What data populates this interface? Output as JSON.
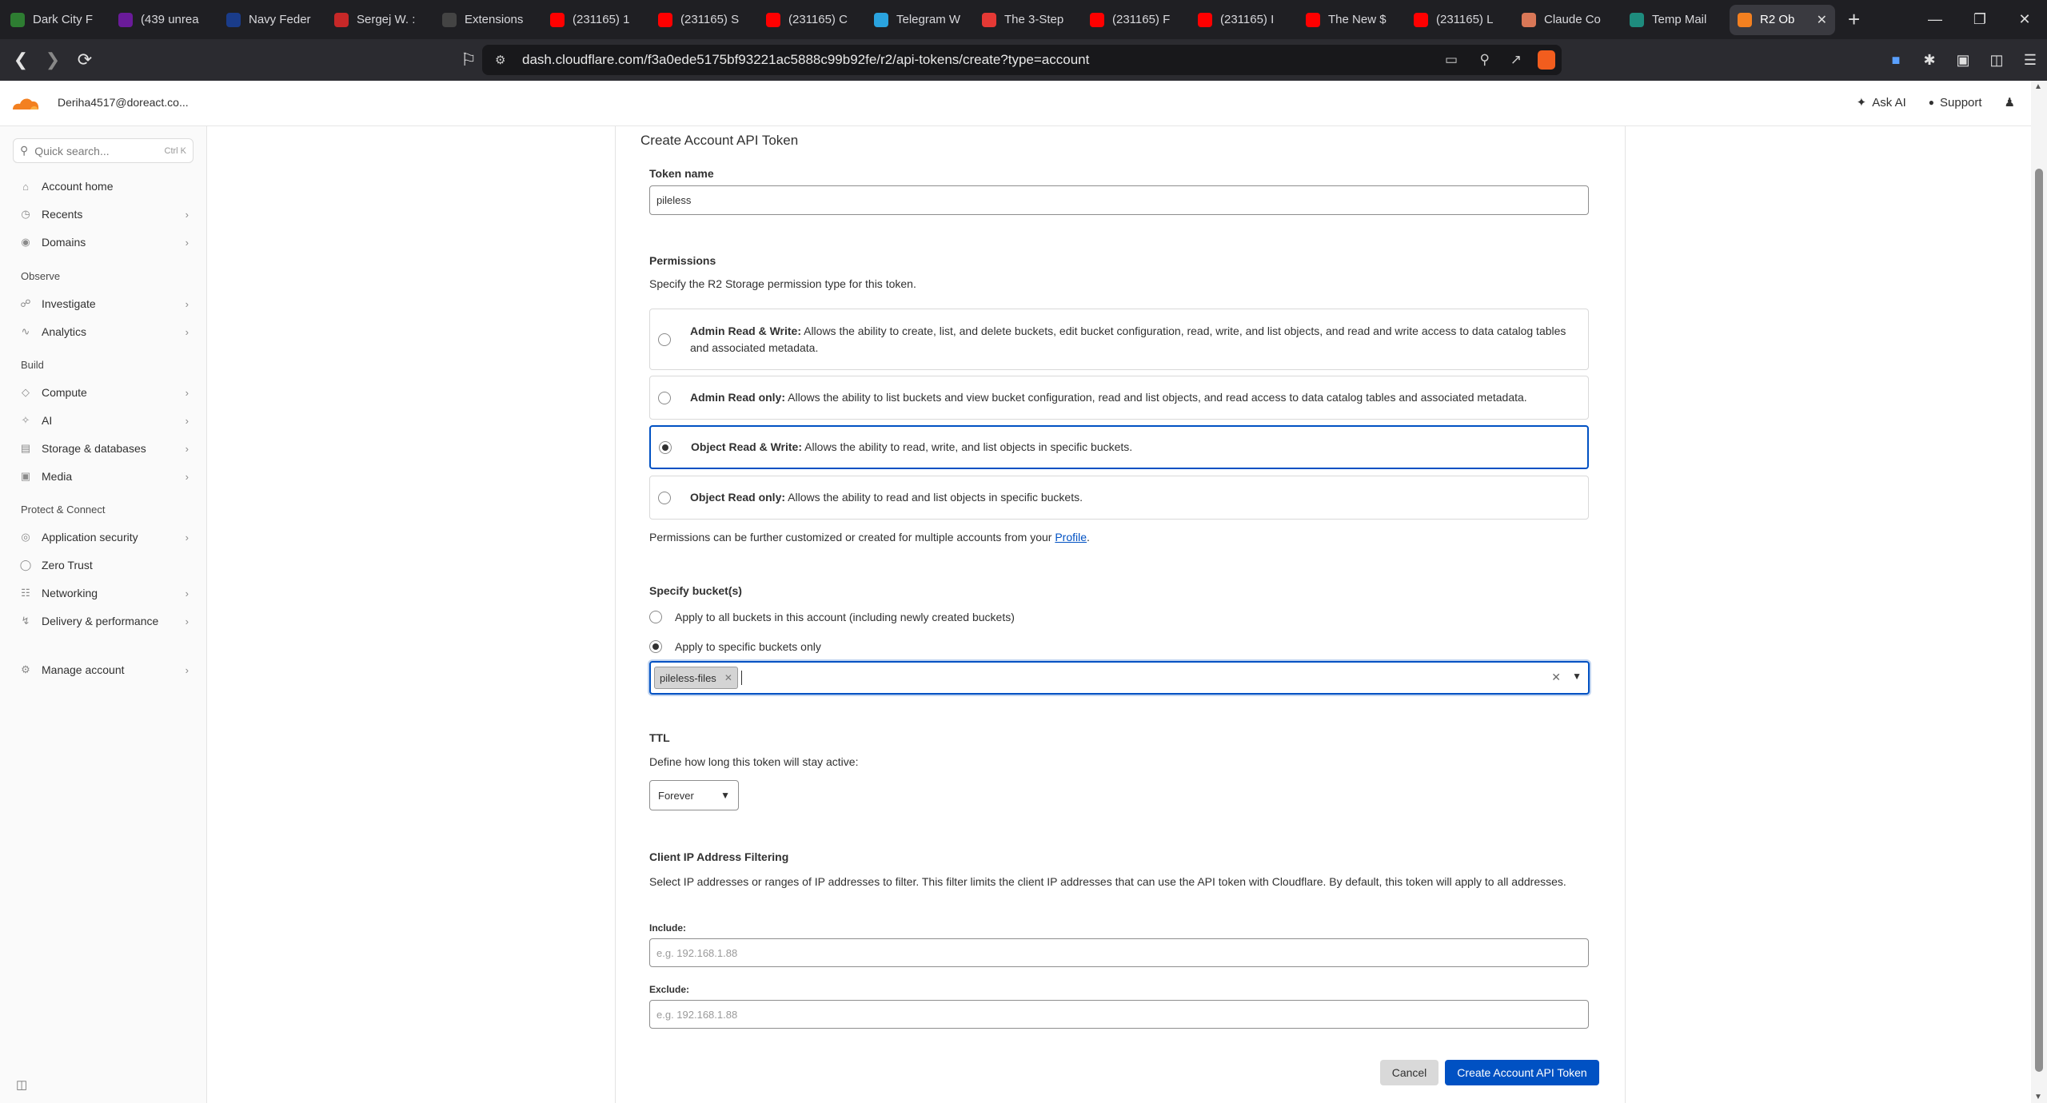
{
  "browser": {
    "tabs": [
      {
        "title": "Dark City F",
        "icon": "play-icon",
        "color": "#2e7d32"
      },
      {
        "title": "(439 unrea",
        "icon": "mail-icon",
        "color": "#6a1b9a"
      },
      {
        "title": "Navy Feder",
        "icon": "globe-icon",
        "color": "#1a3c8a"
      },
      {
        "title": "Sergej W. :",
        "icon": "gmail-icon",
        "color": "#c62828"
      },
      {
        "title": "Extensions",
        "icon": "puzzle-icon",
        "color": "#444444"
      },
      {
        "title": "(231165) 1",
        "icon": "youtube-icon",
        "color": "#ff0000"
      },
      {
        "title": "(231165) S",
        "icon": "youtube-icon",
        "color": "#ff0000"
      },
      {
        "title": "(231165) C",
        "icon": "youtube-icon",
        "color": "#ff0000"
      },
      {
        "title": "Telegram W",
        "icon": "telegram-icon",
        "color": "#2aa3df"
      },
      {
        "title": "The 3-Step",
        "icon": "target-icon",
        "color": "#e53935"
      },
      {
        "title": "(231165) F",
        "icon": "youtube-icon",
        "color": "#ff0000"
      },
      {
        "title": "(231165) I",
        "icon": "youtube-icon",
        "color": "#ff0000"
      },
      {
        "title": "The New $",
        "icon": "youtube-icon",
        "color": "#ff0000"
      },
      {
        "title": "(231165) L",
        "icon": "youtube-icon",
        "color": "#ff0000"
      },
      {
        "title": "Claude Co",
        "icon": "claude-icon",
        "color": "#d97757"
      },
      {
        "title": "Temp Mail",
        "icon": "tempmail-icon",
        "color": "#1e8c7e"
      },
      {
        "title": "R2 Ob",
        "icon": "cloudflare-icon",
        "color": "#f38020"
      }
    ],
    "url": "dash.cloudflare.com/f3a0ede5175bf93221ac5888c99b92fe/r2/api-tokens/create?type=account"
  },
  "header": {
    "account": "Deriha4517@doreact.co...",
    "ask_ai": "Ask AI",
    "support": "Support"
  },
  "sidebar": {
    "search_placeholder": "Quick search...",
    "search_shortcut": "Ctrl K",
    "items": {
      "home": "Account home",
      "recents": "Recents",
      "domains": "Domains",
      "observe": "Observe",
      "investigate": "Investigate",
      "analytics": "Analytics",
      "build": "Build",
      "compute": "Compute",
      "ai": "AI",
      "storage": "Storage & databases",
      "media": "Media",
      "protect": "Protect & Connect",
      "appsec": "Application security",
      "zerotrust": "Zero Trust",
      "networking": "Networking",
      "delivery": "Delivery & performance",
      "manage": "Manage account"
    }
  },
  "form": {
    "title": "Create Account API Token",
    "token_name_label": "Token name",
    "token_name_value": "pileless",
    "permissions_label": "Permissions",
    "permissions_desc": "Specify the R2 Storage permission type for this token.",
    "perms": [
      {
        "title": "Admin Read & Write:",
        "desc": " Allows the ability to create, list, and delete buckets, edit bucket configuration, read, write, and list objects, and read and write access to data catalog tables and associated metadata."
      },
      {
        "title": "Admin Read only:",
        "desc": " Allows the ability to list buckets and view bucket configuration, read and list objects, and read access to data catalog tables and associated metadata."
      },
      {
        "title": "Object Read & Write:",
        "desc": " Allows the ability to read, write, and list objects in specific buckets."
      },
      {
        "title": "Object Read only:",
        "desc": " Allows the ability to read and list objects in specific buckets."
      }
    ],
    "perms_note": "Permissions can be further customized or created for multiple accounts from your ",
    "perms_note_link": "Profile",
    "perms_note_end": ".",
    "buckets_label": "Specify bucket(s)",
    "bucket_all": "Apply to all buckets in this account (including newly created buckets)",
    "bucket_specific": "Apply to specific buckets only",
    "bucket_chip": "pileless-files",
    "ttl_label": "TTL",
    "ttl_desc": "Define how long this token will stay active:",
    "ttl_value": "Forever",
    "ip_label": "Client IP Address Filtering",
    "ip_desc": "Select IP addresses or ranges of IP addresses to filter. This filter limits the client IP addresses that can use the API token with Cloudflare. By default, this token will apply to all addresses.",
    "include_label": "Include:",
    "include_placeholder": "e.g. 192.168.1.88",
    "exclude_label": "Exclude:",
    "exclude_placeholder": "e.g. 192.168.1.88",
    "cancel": "Cancel",
    "create": "Create Account API Token"
  },
  "colors": {
    "accent": "#0051c3",
    "cloudflare_orange": "#f38020"
  }
}
